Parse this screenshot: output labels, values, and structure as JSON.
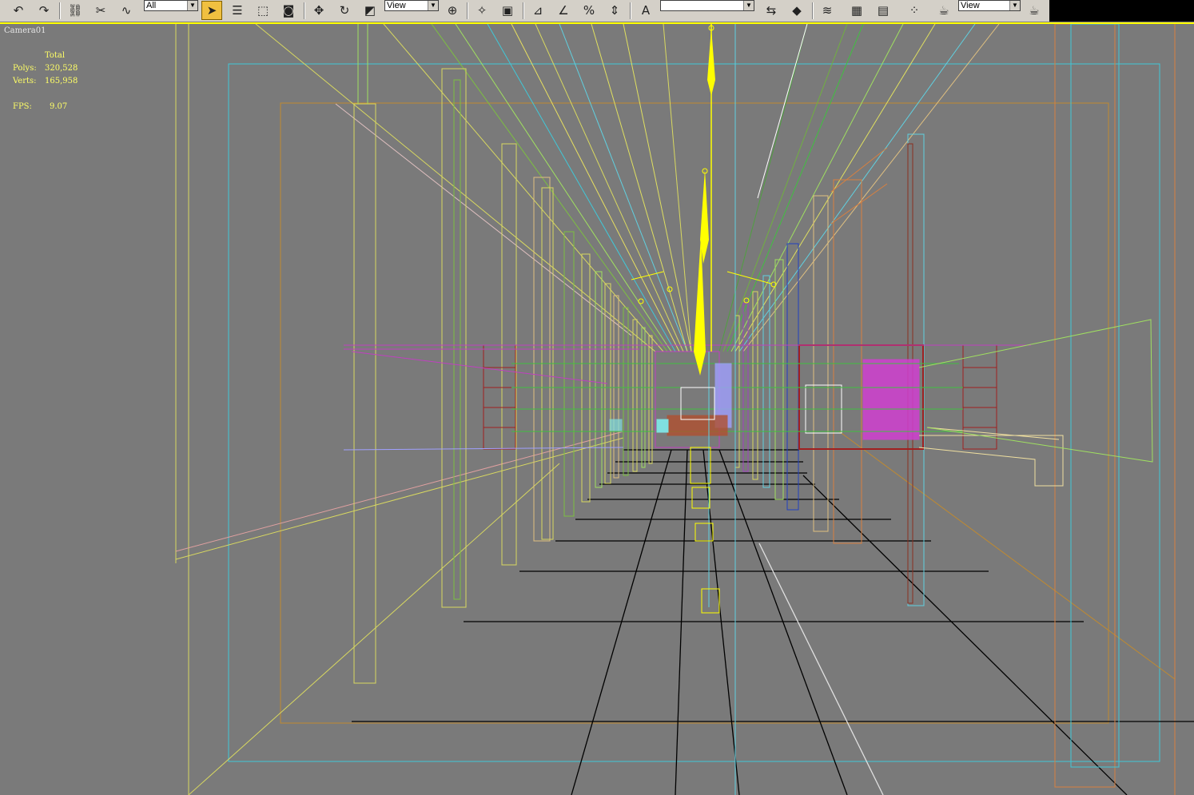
{
  "toolbar": {
    "selection_filter": "All",
    "reference_coord": "View",
    "named_selection": "",
    "render_type": "View",
    "buttons": [
      {
        "name": "undo-icon",
        "glyph": "↶"
      },
      {
        "name": "redo-icon",
        "glyph": "↷"
      },
      {
        "name": "select-and-link-icon",
        "glyph": "⛓"
      },
      {
        "name": "unlink-selection-icon",
        "glyph": "✂"
      },
      {
        "name": "bind-to-space-warp-icon",
        "glyph": "∿"
      },
      {
        "name": "select-object-icon",
        "glyph": "➤"
      },
      {
        "name": "select-by-name-icon",
        "glyph": "☰"
      },
      {
        "name": "rectangular-selection-icon",
        "glyph": "⬚"
      },
      {
        "name": "window-crossing-icon",
        "glyph": "◙"
      },
      {
        "name": "select-and-move-icon",
        "glyph": "✥"
      },
      {
        "name": "select-and-rotate-icon",
        "glyph": "↻"
      },
      {
        "name": "select-and-scale-icon",
        "glyph": "◩"
      },
      {
        "name": "use-pivot-center-icon",
        "glyph": "⊕"
      },
      {
        "name": "select-and-manipulate-icon",
        "glyph": "✧"
      },
      {
        "name": "keyboard-shortcut-override-icon",
        "glyph": "▣"
      },
      {
        "name": "snaps-toggle-icon",
        "glyph": "⊿"
      },
      {
        "name": "angle-snap-icon",
        "glyph": "∠"
      },
      {
        "name": "percent-snap-icon",
        "glyph": "%"
      },
      {
        "name": "spinner-snap-icon",
        "glyph": "⇕"
      },
      {
        "name": "edit-named-selection-icon",
        "glyph": "A"
      },
      {
        "name": "mirror-icon",
        "glyph": "⇆"
      },
      {
        "name": "align-icon",
        "glyph": "◆"
      },
      {
        "name": "layer-manager-icon",
        "glyph": "≋"
      },
      {
        "name": "curve-editor-icon",
        "glyph": "▦"
      },
      {
        "name": "schematic-view-icon",
        "glyph": "▤"
      },
      {
        "name": "material-editor-icon",
        "glyph": "⁘"
      },
      {
        "name": "render-setup-icon",
        "glyph": "☕"
      },
      {
        "name": "quick-render-icon",
        "glyph": "☕"
      }
    ]
  },
  "viewport": {
    "label": "Camera01",
    "stats": {
      "header": "Total",
      "polys_label": "Polys:",
      "polys_value": "320,528",
      "verts_label": "Verts:",
      "verts_value": "165,958",
      "fps_label": "FPS:",
      "fps_value": "9.07"
    },
    "colors": {
      "background": "#7a7a7a",
      "active_border": "#ffff00",
      "stats_text": "#ffff66"
    }
  }
}
